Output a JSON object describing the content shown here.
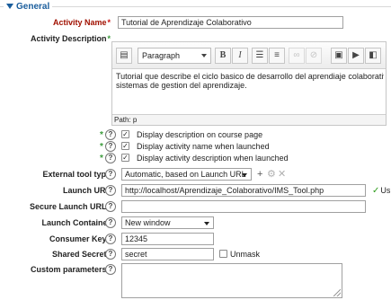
{
  "fieldset": {
    "legend": "General"
  },
  "activity_name": {
    "label": "Activity Name",
    "value": "Tutorial de Aprendizaje Colaborativo"
  },
  "activity_description": {
    "label": "Activity Description",
    "toolbar": {
      "paragraph_select": "Paragraph"
    },
    "content_line1": "Tutorial que describe el ciclo basico de desarrollo del aprendiaje colaborativo y las",
    "content_line2": "sistemas de gestion del aprendizaje.",
    "path": "Path: p"
  },
  "checkboxes": [
    {
      "label": "Display description on course page",
      "checked": true
    },
    {
      "label": "Display activity name when launched",
      "checked": true
    },
    {
      "label": "Display activity description when launched",
      "checked": true
    }
  ],
  "tool_type": {
    "label": "External tool type",
    "value": "Automatic, based on Launch URL"
  },
  "launch_url": {
    "label": "Launch URL",
    "value": "http://localhost/Aprendizaje_Colaborativo/IMS_Tool.php",
    "status": "Us"
  },
  "secure_launch_url": {
    "label": "Secure Launch URL",
    "value": ""
  },
  "launch_container": {
    "label": "Launch Container",
    "value": "New window"
  },
  "consumer_key": {
    "label": "Consumer Key",
    "value": "12345"
  },
  "shared_secret": {
    "label": "Shared Secret",
    "value": "secret",
    "unmask_label": "Unmask"
  },
  "custom_parameters": {
    "label": "Custom parameters",
    "value": ""
  },
  "colors": {
    "legend": "#1a5d9c",
    "required": "#c91414",
    "advanced": "#3c9b3c",
    "valid": "#2e9c1c"
  }
}
